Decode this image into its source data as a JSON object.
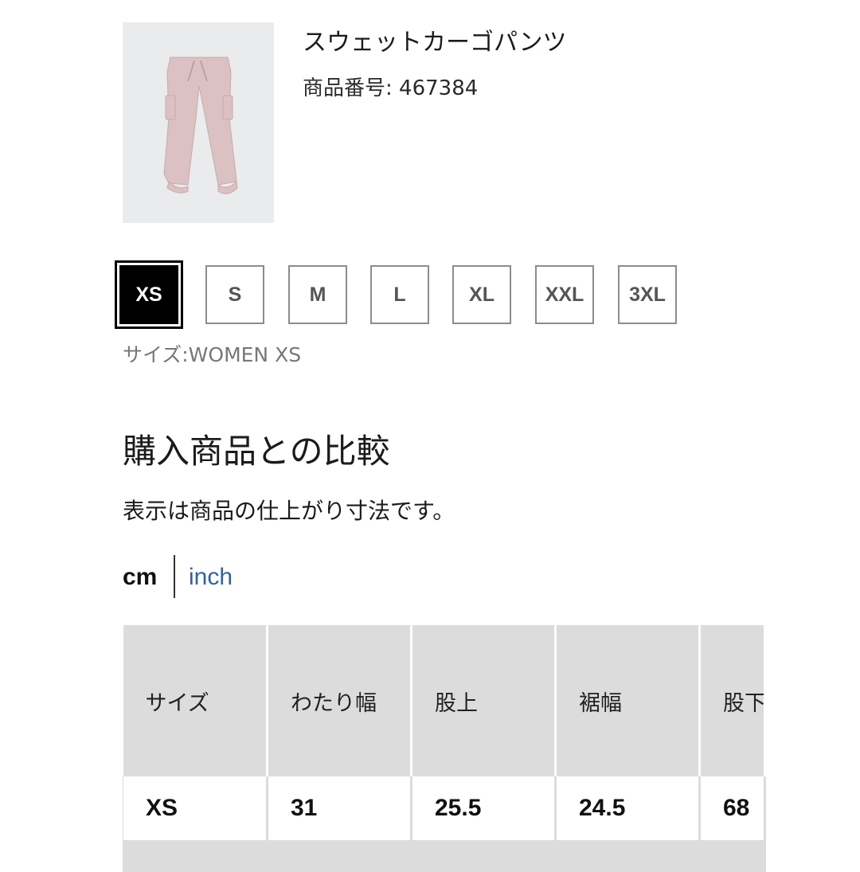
{
  "product": {
    "name": "スウェットカーゴパンツ",
    "number_label": "商品番号: 467384",
    "image_alt": "pink cargo sweatpants",
    "image_color": "#dcc1c3"
  },
  "sizes": {
    "options": [
      "XS",
      "S",
      "M",
      "L",
      "XL",
      "XXL",
      "3XL"
    ],
    "selected": "XS",
    "caption": "サイズ:WOMEN XS"
  },
  "comparison": {
    "title": "購入商品との比較",
    "note": "表示は商品の仕上がり寸法です。",
    "units": {
      "cm": "cm",
      "inch": "inch",
      "active": "cm"
    }
  },
  "table": {
    "headers": [
      "サイズ",
      "わたり幅",
      "股上",
      "裾幅",
      "股下"
    ],
    "rows": [
      [
        "XS",
        "31",
        "25.5",
        "24.5",
        "68"
      ]
    ]
  },
  "colors": {
    "accent_link": "#2b63b0",
    "selected_bg": "#000000",
    "table_header_bg": "#dcdcdc"
  }
}
